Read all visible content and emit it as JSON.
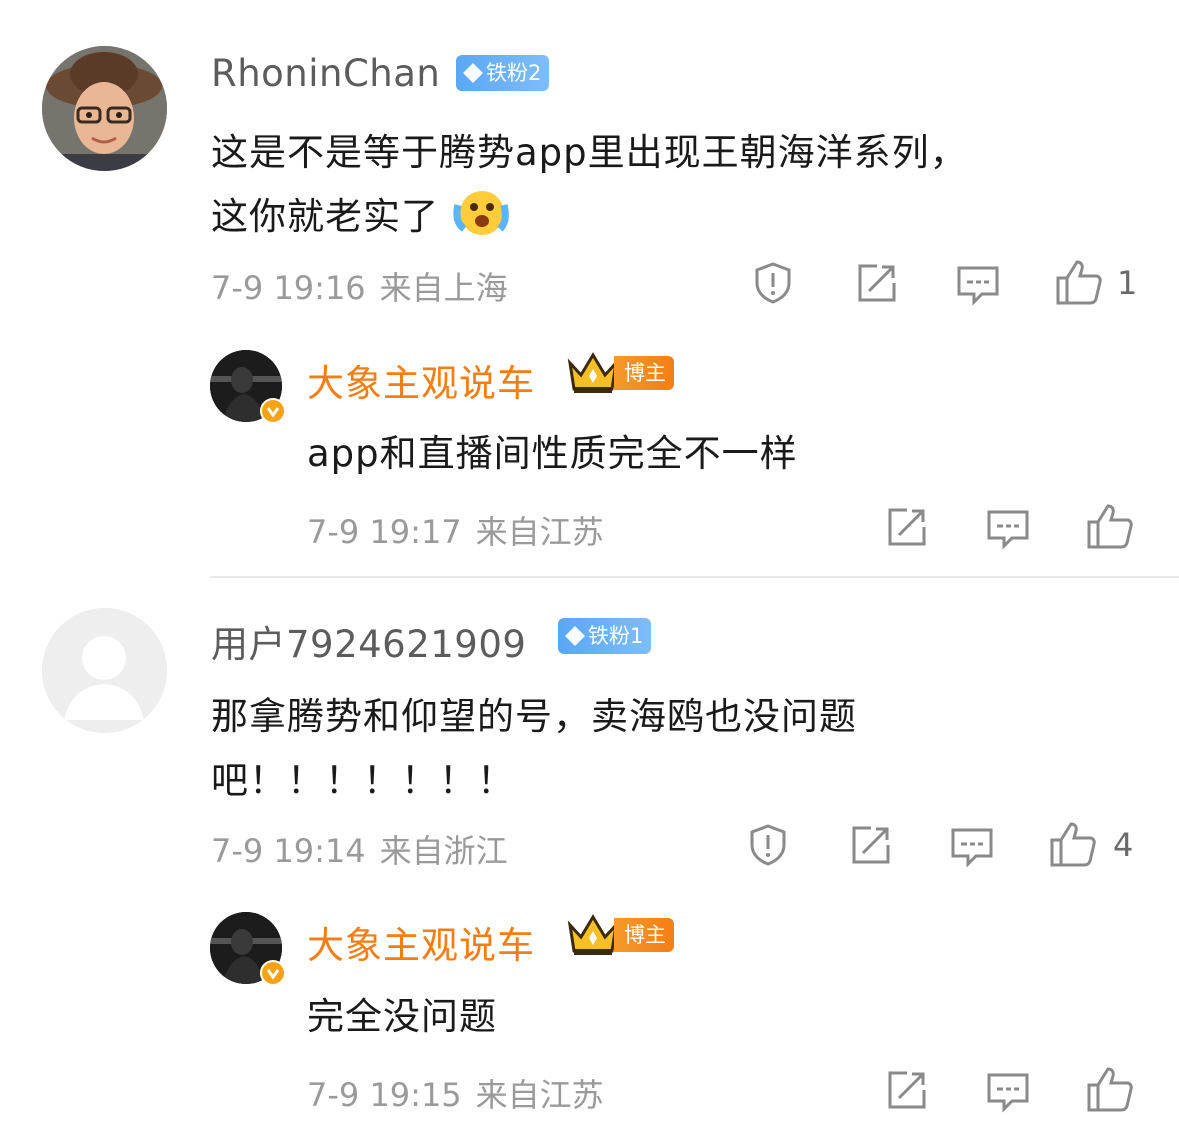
{
  "comments": [
    {
      "user": "RhoninChan",
      "fan_badge": "铁粉2",
      "text_lines": [
        "这是不是等于腾势app里出现王朝海洋系列，",
        "这你就老实了"
      ],
      "emoji": "crying-laughing-emoji",
      "time": "7-9 19:16",
      "location": "来自上海",
      "likes": "1",
      "reply": {
        "user": "大象主观说车",
        "owner_badge": "博主",
        "text": "app和直播间性质完全不一样",
        "time": "7-9 19:17",
        "location": "来自江苏"
      }
    },
    {
      "user": "用户7924621909",
      "fan_badge": "铁粉1",
      "text_lines": [
        "那拿腾势和仰望的号，卖海鸥也没问题",
        "吧！！！！！！！"
      ],
      "time": "7-9 19:14",
      "location": "来自浙江",
      "likes": "4",
      "reply": {
        "user": "大象主观说车",
        "owner_badge": "博主",
        "text": "完全没问题",
        "time": "7-9 19:15",
        "location": "来自江苏"
      }
    }
  ],
  "icons": [
    "report-icon",
    "repost-icon",
    "comment-icon",
    "like-icon",
    "diamond-icon",
    "crown-icon",
    "verified-icon"
  ],
  "colors": {
    "name_gray": "#5c5c5c",
    "blogger_orange": "#f47e14",
    "fan_badge_blue": "#5aa7f5",
    "meta_gray": "#9a9a9a"
  }
}
